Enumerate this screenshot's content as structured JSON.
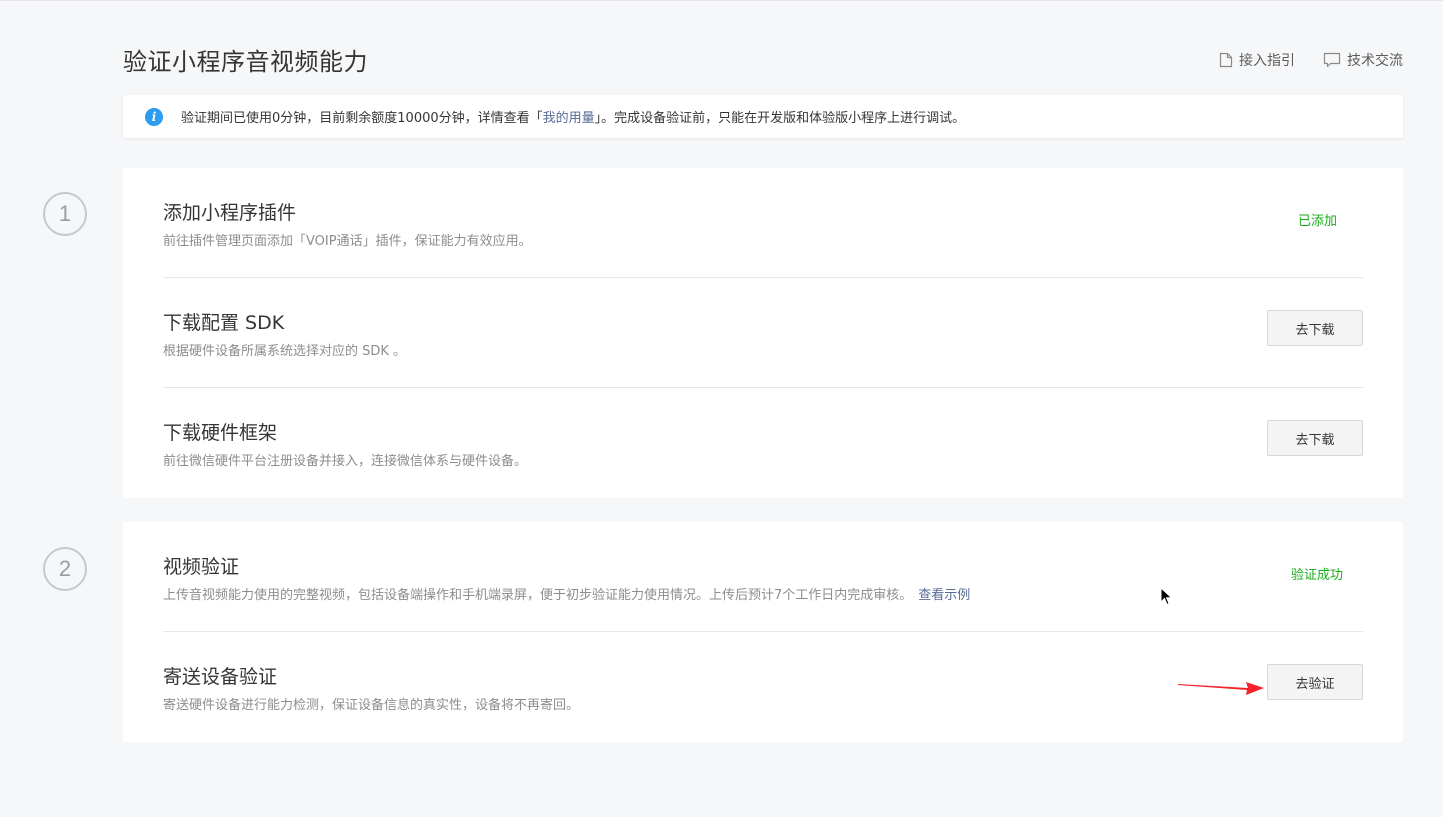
{
  "page": {
    "title": "验证小程序音视频能力",
    "links": [
      {
        "label": "接入指引",
        "icon": "document-icon"
      },
      {
        "label": "技术交流",
        "icon": "chat-bubble-icon"
      }
    ]
  },
  "notice": {
    "icon": "info-icon",
    "text_before": "验证期间已使用0分钟，目前剩余额度10000分钟，详情查看「",
    "link_text": "我的用量",
    "text_after": "」。完成设备验证前，只能在开发版和体验版小程序上进行调试。"
  },
  "steps": [
    {
      "number": "1",
      "items": [
        {
          "title": "添加小程序插件",
          "desc": "前往插件管理页面添加「VOIP通话」插件，保证能力有效应用。",
          "status": "已添加"
        },
        {
          "title": "下载配置 SDK",
          "desc": "根据硬件设备所属系统选择对应的 SDK 。",
          "button": "去下载"
        },
        {
          "title": "下载硬件框架",
          "desc": "前往微信硬件平台注册设备并接入，连接微信体系与硬件设备。",
          "button": "去下载"
        }
      ]
    },
    {
      "number": "2",
      "items": [
        {
          "title": "视频验证",
          "desc": "上传音视频能力使用的完整视频，包括设备端操作和手机端录屏，便于初步验证能力使用情况。上传后预计7个工作日内完成审核。",
          "link": "查看示例",
          "status": "验证成功"
        },
        {
          "title": "寄送设备验证",
          "desc": "寄送硬件设备进行能力检测，保证设备信息的真实性，设备将不再寄回。",
          "button": "去验证"
        }
      ]
    }
  ],
  "colors": {
    "success": "#1aad19",
    "link": "#576b95",
    "info": "#2d9bf0",
    "annotation_arrow": "#f5222d"
  }
}
